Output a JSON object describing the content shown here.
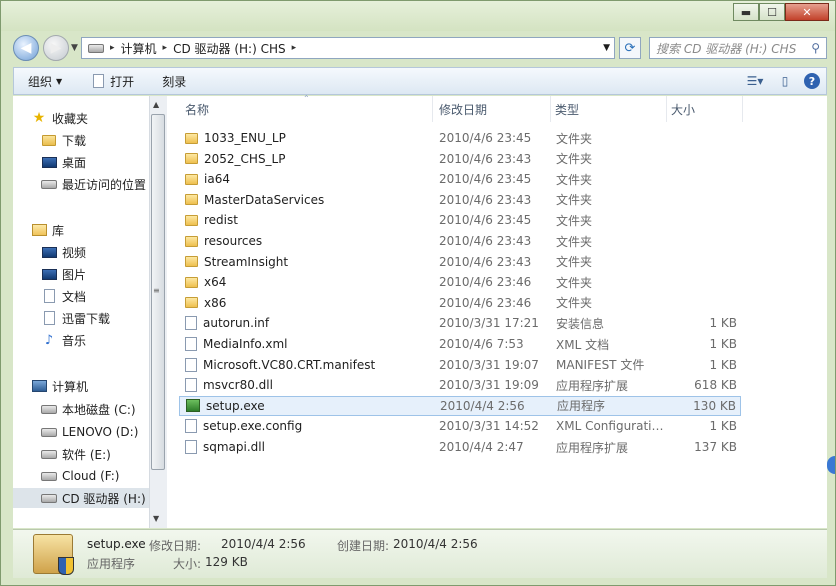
{
  "window": {
    "minimize": "▬",
    "maximize": "☐",
    "close": "✕"
  },
  "address": {
    "crumbs": [
      "计算机",
      "CD 驱动器 (H:) CHS"
    ],
    "sep": "▸"
  },
  "search": {
    "placeholder": "搜索 CD 驱动器 (H:) CHS"
  },
  "toolbar": {
    "organize": "组织",
    "open": "打开",
    "burn": "刻录"
  },
  "nav": {
    "favorites": "收藏夹",
    "downloads": "下载",
    "desktop": "桌面",
    "recent": "最近访问的位置",
    "libraries": "库",
    "videos": "视频",
    "pictures": "图片",
    "documents": "文档",
    "xunlei": "迅雷下载",
    "music": "音乐",
    "computer": "计算机",
    "drive_c": "本地磁盘 (C:)",
    "drive_d": "LENOVO (D:)",
    "drive_e": "软件 (E:)",
    "drive_f": "Cloud (F:)",
    "drive_h": "CD 驱动器 (H:) C"
  },
  "columns": {
    "name": "名称",
    "modified": "修改日期",
    "type": "类型",
    "size": "大小"
  },
  "files": [
    {
      "name": "1033_ENU_LP",
      "date": "2010/4/6 23:45",
      "type": "文件夹",
      "size": "",
      "icon": "folder-icon"
    },
    {
      "name": "2052_CHS_LP",
      "date": "2010/4/6 23:43",
      "type": "文件夹",
      "size": "",
      "icon": "folder-icon"
    },
    {
      "name": "ia64",
      "date": "2010/4/6 23:45",
      "type": "文件夹",
      "size": "",
      "icon": "folder-icon"
    },
    {
      "name": "MasterDataServices",
      "date": "2010/4/6 23:43",
      "type": "文件夹",
      "size": "",
      "icon": "folder-icon"
    },
    {
      "name": "redist",
      "date": "2010/4/6 23:45",
      "type": "文件夹",
      "size": "",
      "icon": "folder-icon"
    },
    {
      "name": "resources",
      "date": "2010/4/6 23:43",
      "type": "文件夹",
      "size": "",
      "icon": "folder-icon"
    },
    {
      "name": "StreamInsight",
      "date": "2010/4/6 23:43",
      "type": "文件夹",
      "size": "",
      "icon": "folder-icon"
    },
    {
      "name": "x64",
      "date": "2010/4/6 23:46",
      "type": "文件夹",
      "size": "",
      "icon": "folder-icon"
    },
    {
      "name": "x86",
      "date": "2010/4/6 23:46",
      "type": "文件夹",
      "size": "",
      "icon": "folder-icon"
    },
    {
      "name": "autorun.inf",
      "date": "2010/3/31 17:21",
      "type": "安装信息",
      "size": "1 KB",
      "icon": "settings-file-icon"
    },
    {
      "name": "MediaInfo.xml",
      "date": "2010/4/6 7:53",
      "type": "XML 文档",
      "size": "1 KB",
      "icon": "xml-file-icon"
    },
    {
      "name": "Microsoft.VC80.CRT.manifest",
      "date": "2010/3/31 19:07",
      "type": "MANIFEST 文件",
      "size": "1 KB",
      "icon": "blank-file-icon"
    },
    {
      "name": "msvcr80.dll",
      "date": "2010/3/31 19:09",
      "type": "应用程序扩展",
      "size": "618 KB",
      "icon": "dll-file-icon"
    },
    {
      "name": "setup.exe",
      "date": "2010/4/4 2:56",
      "type": "应用程序",
      "size": "130 KB",
      "icon": "exe-file-icon"
    },
    {
      "name": "setup.exe.config",
      "date": "2010/3/31 14:52",
      "type": "XML Configurati…",
      "size": "1 KB",
      "icon": "config-file-icon"
    },
    {
      "name": "sqmapi.dll",
      "date": "2010/4/4 2:47",
      "type": "应用程序扩展",
      "size": "137 KB",
      "icon": "dll-file-icon"
    }
  ],
  "details": {
    "name": "setup.exe",
    "type": "应用程序",
    "modified_label": "修改日期:",
    "modified_value": "2010/4/4 2:56",
    "size_label": "大小:",
    "size_value": "129 KB",
    "created_label": "创建日期:",
    "created_value": "2010/4/4 2:56"
  }
}
